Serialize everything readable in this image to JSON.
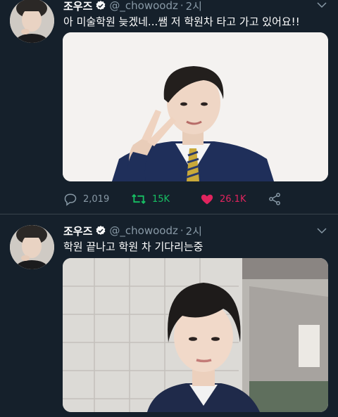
{
  "tweets": [
    {
      "author_name": "조우즈",
      "handle": "@_chowoodz",
      "separator": "·",
      "time": "2시",
      "text": "아 미술학원 늦겠네...쌤 저 학원차 타고 가고 있어요!!",
      "icons": [
        "verified-badge",
        "chevron-down",
        "reply",
        "retweet",
        "heart-filled",
        "share"
      ],
      "stats": {
        "replies": "2,019",
        "retweets": "15K",
        "likes": "26.1K"
      },
      "retweeted": true,
      "liked": true
    },
    {
      "author_name": "조우즈",
      "handle": "@_chowoodz",
      "separator": "·",
      "time": "2시",
      "text": "학원 끝나고 학원 차 기다리는중",
      "icons": [
        "verified-badge",
        "chevron-down"
      ]
    }
  ],
  "colors": {
    "background": "#15202b",
    "divider": "#38444d",
    "secondary_text": "#8899a6",
    "verified_blue": "#1da1f2",
    "retweet_green": "#17bf63",
    "like_pink": "#e0245e"
  }
}
